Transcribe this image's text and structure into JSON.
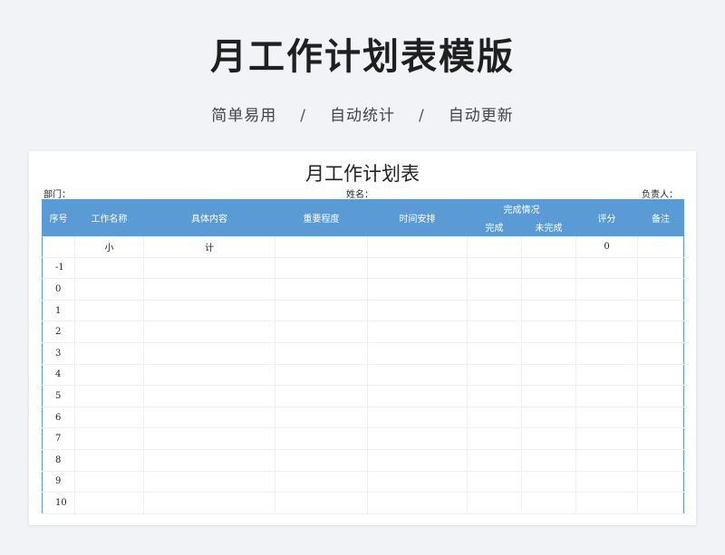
{
  "hero": {
    "title": "月工作计划表模版",
    "features": [
      "简单易用",
      "自动统计",
      "自动更新"
    ],
    "separator": "/"
  },
  "sheet": {
    "title": "月工作计划表",
    "department_label": "部门：",
    "name_label": "姓名：",
    "owner_label": "负责人：",
    "headers": {
      "index": "序号",
      "task_name": "工作名称",
      "content": "具体内容",
      "importance": "重要程度",
      "schedule": "时间安排",
      "completion": "完成情况",
      "done": "完成",
      "not_done": "未完成",
      "score": "评分",
      "notes": "备注"
    },
    "subtotal": {
      "label_a": "小",
      "label_b": "计",
      "score": "0"
    },
    "rows": [
      "-1",
      "0",
      "1",
      "2",
      "3",
      "4",
      "5",
      "6",
      "7",
      "8",
      "9",
      "10"
    ]
  }
}
